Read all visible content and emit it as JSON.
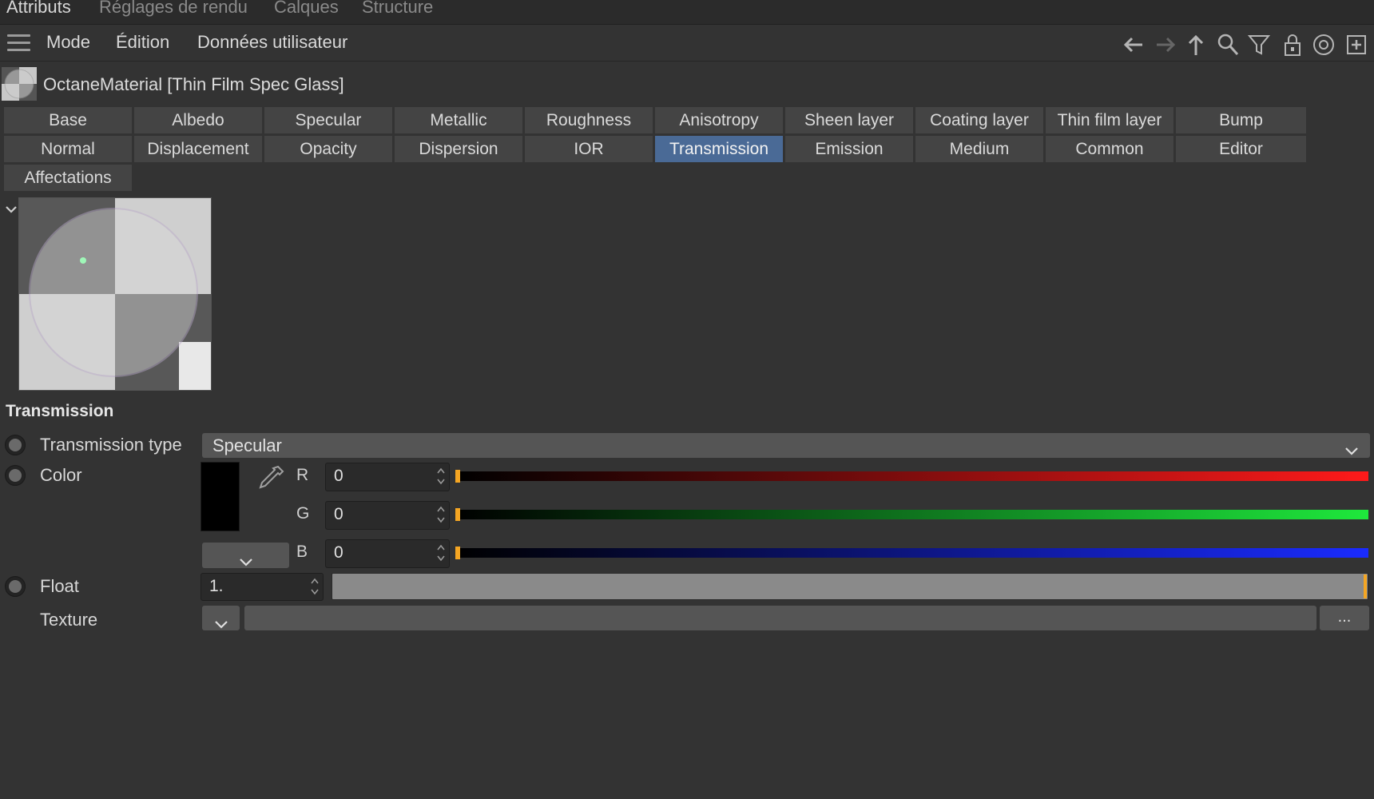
{
  "top_tabs": [
    {
      "label": "Attributs",
      "active": true
    },
    {
      "label": "Réglages de rendu",
      "active": false
    },
    {
      "label": "Calques",
      "active": false
    },
    {
      "label": "Structure",
      "active": false
    }
  ],
  "menu": {
    "mode": "Mode",
    "edition": "Édition",
    "user_data": "Données utilisateur"
  },
  "toolbar_icons": [
    "arrow-left-icon",
    "arrow-right-icon",
    "arrow-up-icon",
    "search-icon",
    "filter-icon",
    "lock-icon",
    "target-icon",
    "new-panel-icon"
  ],
  "object": {
    "title": "OctaneMaterial [Thin Film Spec Glass]"
  },
  "tabs_row1": [
    "Base",
    "Albedo",
    "Specular",
    "Metallic",
    "Roughness",
    "Anisotropy",
    "Sheen layer",
    "Coating layer",
    "Thin film layer",
    "Bump"
  ],
  "tabs_row2": [
    "Normal",
    "Displacement",
    "Opacity",
    "Dispersion",
    "IOR",
    "Transmission",
    "Emission",
    "Medium",
    "Common",
    "Editor"
  ],
  "tabs_row3": [
    "Affectations"
  ],
  "active_tab": "Transmission",
  "section": {
    "title": "Transmission"
  },
  "transmission_type": {
    "label": "Transmission type",
    "value": "Specular"
  },
  "color": {
    "label": "Color",
    "swatch": "#000000",
    "r": {
      "label": "R",
      "value": "0"
    },
    "g": {
      "label": "G",
      "value": "0"
    },
    "b": {
      "label": "B",
      "value": "0"
    }
  },
  "float": {
    "label": "Float",
    "value": "1.",
    "level": 1.0
  },
  "texture": {
    "label": "Texture",
    "browse_label": "..."
  },
  "colors": {
    "accent": "#4a6a96",
    "knob": "#f5a623"
  }
}
